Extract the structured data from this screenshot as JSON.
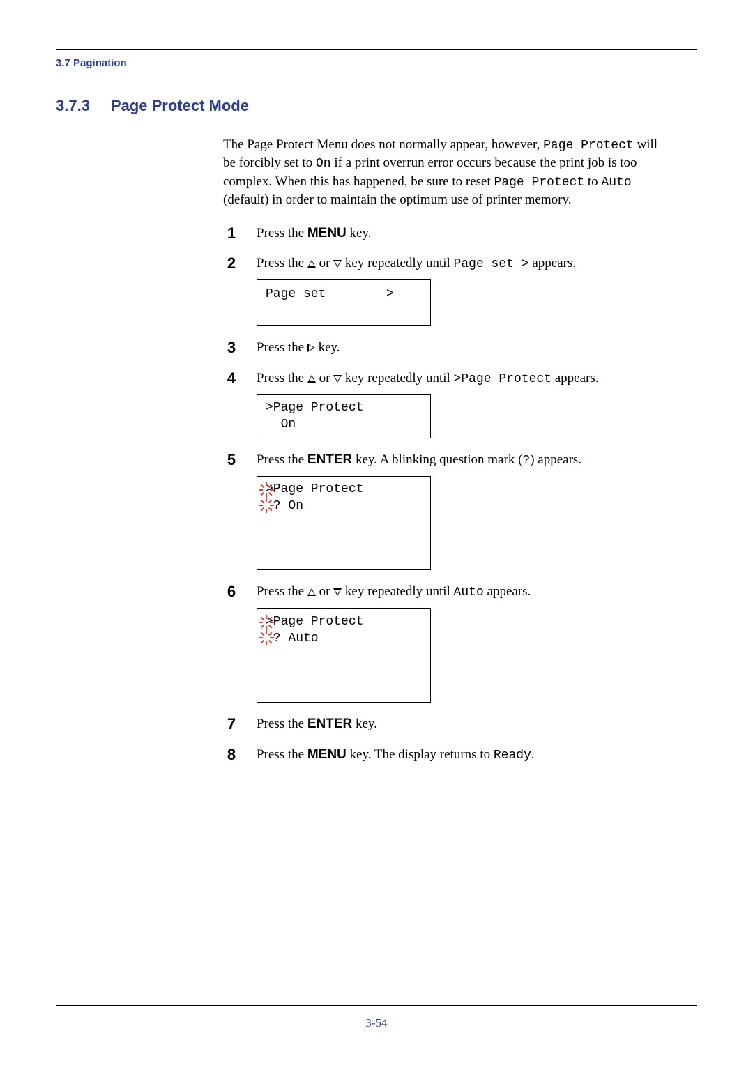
{
  "header": {
    "breadcrumb": "3.7 Pagination"
  },
  "section": {
    "number": "3.7.3",
    "title": "Page Protect Mode"
  },
  "intro": {
    "p1a": "The Page Protect Menu does not normally appear, however, ",
    "code1": "Page Protect",
    "p1b": " will be forcibly set to ",
    "code2": "On",
    "p1c": " if a print overrun error occurs because the print job is too complex. When this has happened, be sure to reset ",
    "code3": "Page  Protect",
    "p1d": " to ",
    "code4": "Auto",
    "p1e": " (default) in order to maintain the optimum use of printer memory."
  },
  "steps": {
    "s1": {
      "num": "1",
      "t1": "Press the ",
      "key": "MENU",
      "t2": " key."
    },
    "s2": {
      "num": "2",
      "t1": "Press the ",
      "t2": " or ",
      "t3": " key repeatedly until ",
      "code": "Page set  >",
      "t4": " appears.",
      "lcd": "Page set        >\n "
    },
    "s3": {
      "num": "3",
      "t1": "Press the ",
      "t2": " key."
    },
    "s4": {
      "num": "4",
      "t1": "Press the ",
      "t2": " or ",
      "t3": " key repeatedly until ",
      "code": ">Page Protect",
      "t4": " appears.",
      "lcd": ">Page Protect\n  On"
    },
    "s5": {
      "num": "5",
      "t1": "Press the ",
      "key": "ENTER",
      "t2": " key. A blinking question mark (",
      "code": "?",
      "t3": ") appears.",
      "lcd": ">Page Protect\n ? On"
    },
    "s6": {
      "num": "6",
      "t1": "Press the ",
      "t2": " or ",
      "t3": " key repeatedly until ",
      "code": "Auto",
      "t4": " appears.",
      "lcd": ">Page Protect\n ? Auto"
    },
    "s7": {
      "num": "7",
      "t1": "Press the ",
      "key": "ENTER",
      "t2": " key."
    },
    "s8": {
      "num": "8",
      "t1": "Press the ",
      "key": "MENU",
      "t2": " key. The display returns to ",
      "code": "Ready",
      "t3": "."
    }
  },
  "footer": {
    "page": "3-54"
  }
}
